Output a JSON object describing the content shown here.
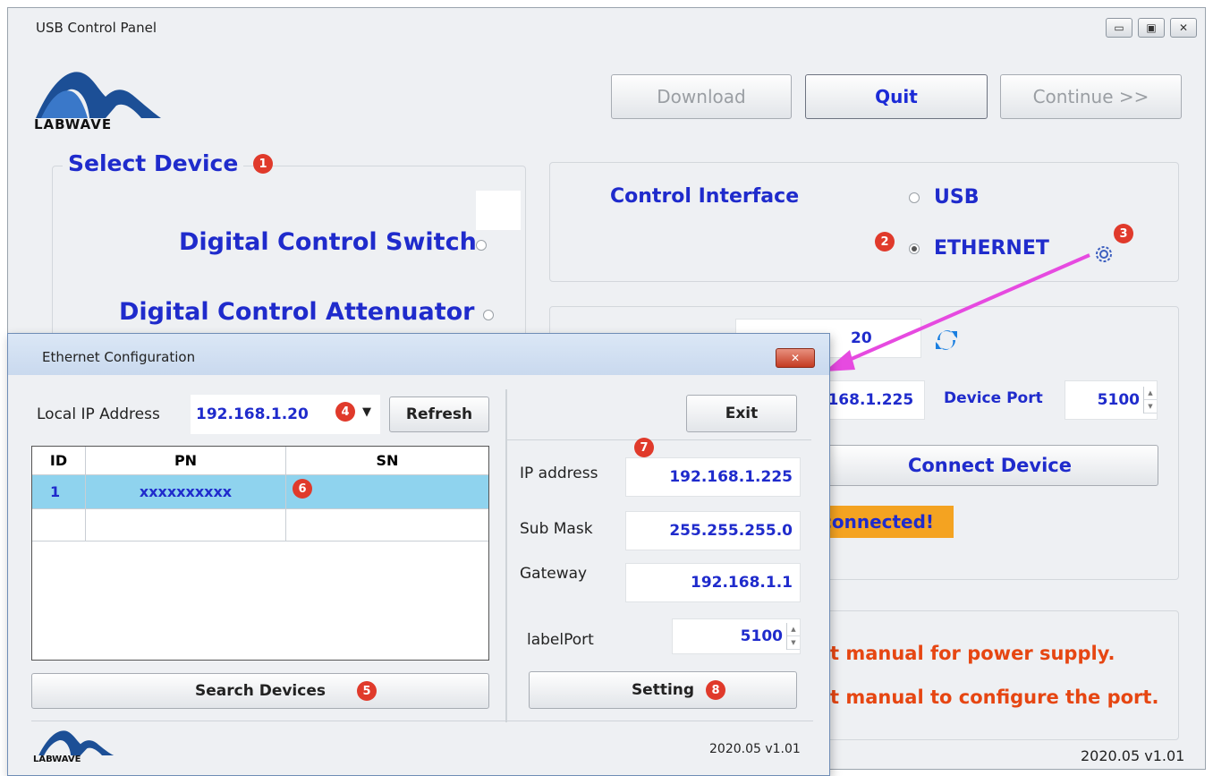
{
  "main_window": {
    "title": "USB Control Panel",
    "window_controls": [
      "minimize-icon",
      "maximize-icon",
      "close-icon"
    ],
    "logo_text": "LABWAVE",
    "buttons": {
      "download": "Download",
      "quit": "Quit",
      "continue": "Continue >>"
    },
    "select_device": {
      "title": "Select Device",
      "badge": "1",
      "options": [
        "Digital Control Switch",
        "Digital Control Attenuator"
      ]
    },
    "control_interface": {
      "label": "Control Interface",
      "usb_label": "USB",
      "ethernet_label": "ETHERNET",
      "ethernet_badge": "2",
      "settings_badge": "3",
      "selected": "ETHERNET"
    },
    "connection": {
      "local_ip_fragment": "20",
      "device_ip_fragment": ".168.1.225",
      "device_port_label": "Device Port",
      "device_port_value": "5100",
      "connect_button": "Connect Device",
      "status_fragment": "connected!"
    },
    "notes": {
      "line1": "t manual for power supply.",
      "line2": "t manual to configure the port."
    },
    "version": "2020.05 v1.01"
  },
  "dialog": {
    "title": "Ethernet Configuration",
    "local_ip_label": "Local IP Address",
    "local_ip_value": "192.168.1.20",
    "local_ip_badge": "4",
    "refresh_button": "Refresh",
    "exit_button": "Exit",
    "table": {
      "columns": [
        "ID",
        "PN",
        "SN"
      ],
      "rows": [
        {
          "id": "1",
          "pn": "xxxxxxxxxx",
          "sn": ""
        }
      ],
      "row_badge": "6"
    },
    "search_button": "Search Devices",
    "search_badge": "5",
    "settings_badge": "7",
    "ip_address_label": "IP address",
    "ip_address_value": "192.168.1.225",
    "sub_mask_label": "Sub Mask",
    "sub_mask_value": "255.255.255.0",
    "gateway_label": "Gateway",
    "gateway_value": "192.168.1.1",
    "port_label": "labelPort",
    "port_value": "5100",
    "setting_button": "Setting",
    "setting_badge": "8",
    "logo_text": "LABWAVE",
    "version": "2020.05 v1.01"
  },
  "colors": {
    "accent_blue": "#1f2bcc",
    "badge_red": "#e03a2b",
    "status_orange": "#f4a321",
    "note_red": "#e64612",
    "arrow_magenta": "#e64ae0"
  }
}
